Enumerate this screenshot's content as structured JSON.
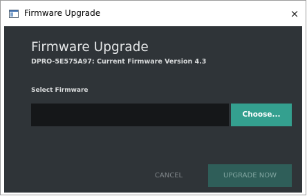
{
  "window": {
    "title": "Firmware Upgrade",
    "close_glyph": "×",
    "icon": "app-window-icon"
  },
  "dialog": {
    "heading": "Firmware Upgrade",
    "subheading": "DPRO-5E575A97: Current Firmware Version 4.3",
    "select_label": "Select Firmware",
    "file_value": "",
    "choose_label": "Choose...",
    "cancel_label": "CANCEL",
    "upgrade_label": "UPGRADE NOW"
  },
  "colors": {
    "dialog_bg": "#2f3438",
    "input_bg": "#151719",
    "accent": "#34a08f",
    "disabled_accent": "#2f5e59",
    "muted_text": "#80868a"
  }
}
